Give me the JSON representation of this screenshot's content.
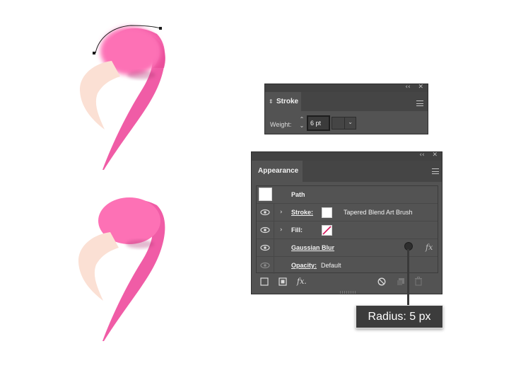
{
  "colors": {
    "flamingo_pink": "#f05ca6",
    "head_pink": "#fd71b5",
    "beak": "#fbe0d4",
    "panel_bg": "#535353",
    "panel_dark": "#424242"
  },
  "stroke_panel": {
    "collapse_icon": "double-chevron-left-icon",
    "close_icon": "close-icon",
    "tab_label": "Stroke",
    "weight_label": "Weight:",
    "weight_value": "6 pt",
    "menu_icon": "hamburger-icon"
  },
  "appearance_panel": {
    "tab_label": "Appearance",
    "rows": [
      {
        "label": "Path"
      },
      {
        "label": "Stroke:",
        "value": "Tapered Blend Art Brush"
      },
      {
        "label": "Fill:"
      },
      {
        "label": "Gaussian Blur",
        "fx": "fx"
      },
      {
        "label": "Opacity:",
        "value": "Default"
      }
    ],
    "footer_icons": [
      "new-stroke-icon",
      "new-fill-icon",
      "fx-icon",
      "clear-icon",
      "duplicate-icon",
      "trash-icon"
    ],
    "footer_fx": "fx."
  },
  "tooltip": {
    "text": "Radius: 5 px",
    "radius": 5
  }
}
